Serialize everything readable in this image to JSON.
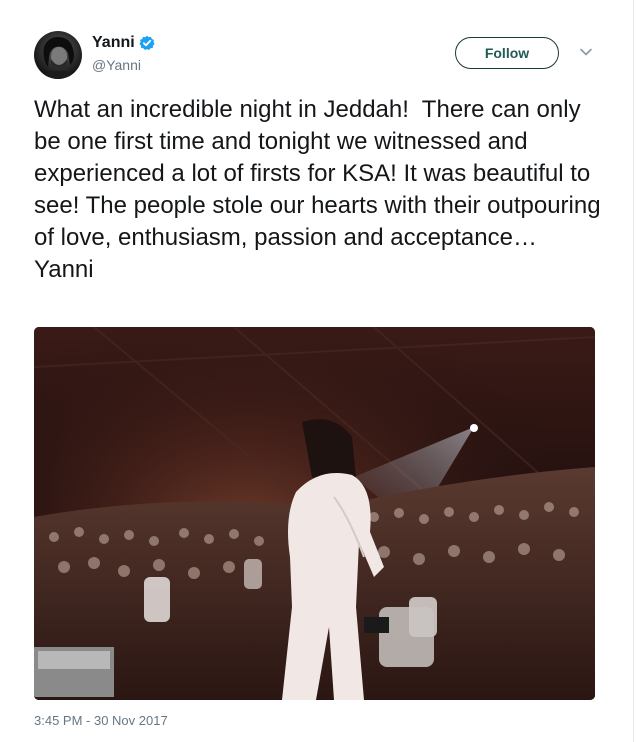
{
  "author": {
    "display_name": "Yanni",
    "handle": "@Yanni",
    "verified": true,
    "avatar_icon": "profile-photo"
  },
  "actions": {
    "follow_label": "Follow",
    "more_icon": "chevron-down-icon"
  },
  "tweet": {
    "text": "What an incredible night in Jeddah!  There can only be one first time and tonight we witnessed and experienced a lot of firsts for KSA! It was beautiful to see! The people stole our hearts with their outpouring of love, enthusiasm, passion and acceptance…\nYanni",
    "timestamp": "3:45 PM - 30 Nov 2017"
  },
  "colors": {
    "verified_blue": "#1da1f2",
    "follow_border": "#1a3a36",
    "secondary_text": "#657786"
  }
}
